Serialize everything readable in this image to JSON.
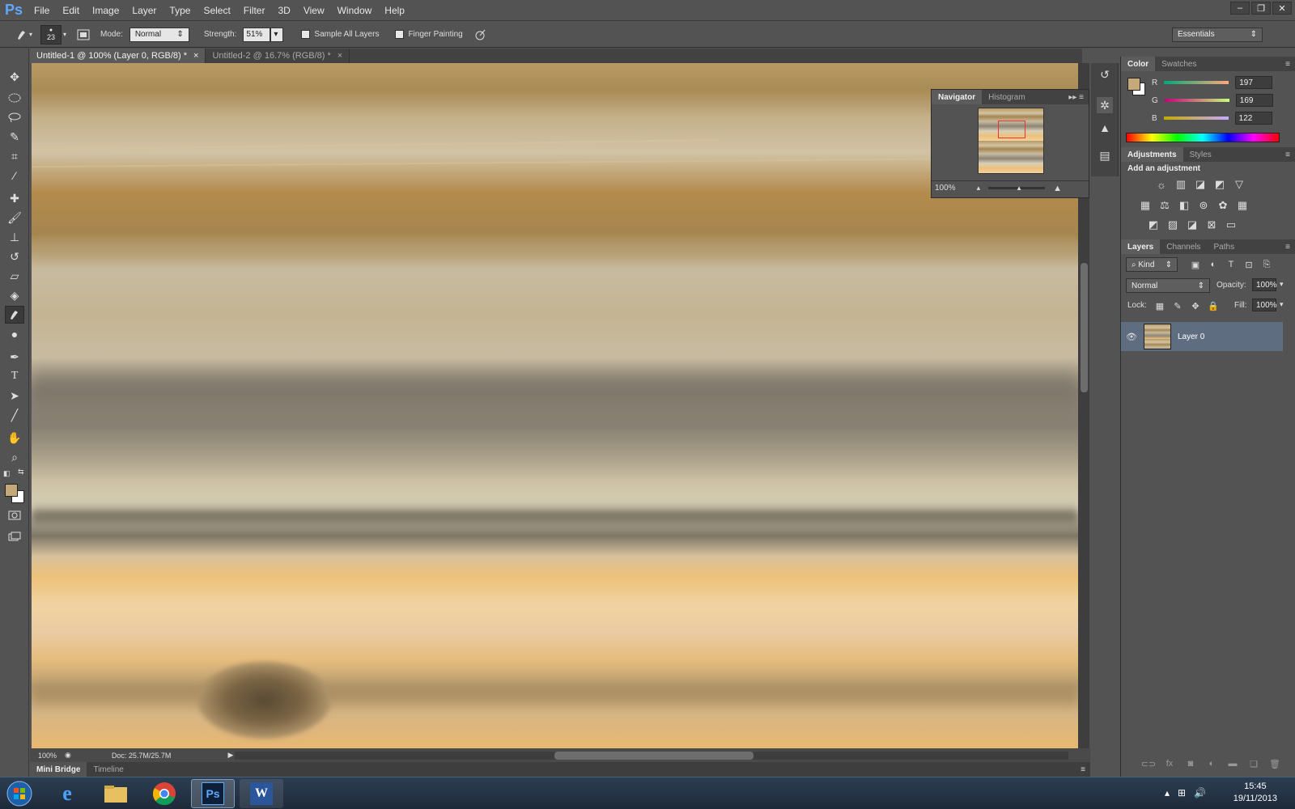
{
  "app": {
    "logo": "Ps"
  },
  "menu": [
    "File",
    "Edit",
    "Image",
    "Layer",
    "Type",
    "Select",
    "Filter",
    "3D",
    "View",
    "Window",
    "Help"
  ],
  "window_controls": {
    "minimize": "–",
    "restore": "❐",
    "close": "✕"
  },
  "options": {
    "brush_size": "23",
    "mode_label": "Mode:",
    "mode_value": "Normal",
    "strength_label": "Strength:",
    "strength_value": "51%",
    "sample_all_layers": "Sample All Layers",
    "finger_painting": "Finger Painting",
    "workspace": "Essentials"
  },
  "tabs": [
    {
      "label": "Untitled-1 @ 100% (Layer 0, RGB/8) *",
      "close": "×"
    },
    {
      "label": "Untitled-2 @ 16.7% (RGB/8) *",
      "close": "×"
    }
  ],
  "status": {
    "zoom": "100%",
    "doc": "Doc: 25.7M/25.7M"
  },
  "bottom_tabs": [
    "Mini Bridge",
    "Timeline"
  ],
  "navigator": {
    "tab_active": "Navigator",
    "tab_inactive": "Histogram",
    "zoom": "100%"
  },
  "color_panel": {
    "tab_active": "Color",
    "tab_inactive": "Swatches",
    "r_label": "R",
    "g_label": "G",
    "b_label": "B",
    "r": "197",
    "g": "169",
    "b": "122",
    "foreground": "#c5a97a"
  },
  "adjustments_panel": {
    "tab_active": "Adjustments",
    "tab_inactive": "Styles",
    "title": "Add an adjustment"
  },
  "layers_panel": {
    "tabs": [
      "Layers",
      "Channels",
      "Paths"
    ],
    "filter_kind": "Kind",
    "blend_mode": "Normal",
    "opacity_label": "Opacity:",
    "opacity": "100%",
    "lock_label": "Lock:",
    "fill_label": "Fill:",
    "fill": "100%",
    "layer_name": "Layer 0"
  },
  "taskbar": {
    "time": "15:45",
    "date": "19/11/2013"
  }
}
